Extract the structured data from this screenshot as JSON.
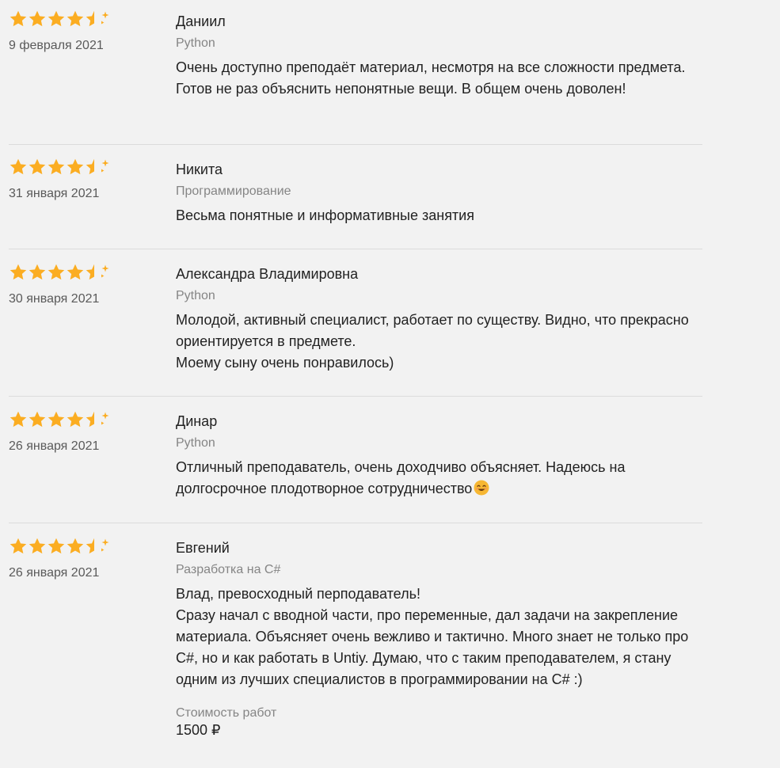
{
  "colors": {
    "star": "#fbad22",
    "text": "#222222",
    "muted": "#858585",
    "divider": "#dcdcdc",
    "background": "#f2f2f2"
  },
  "reviews": [
    {
      "rating": 4.5,
      "date": "9 февраля 2021",
      "author": "Даниил",
      "subject": "Python",
      "text": "Очень доступно преподаёт материал, несмотря на все сложности предмета. Готов не раз объяснить непонятные вещи. В общем очень доволен!"
    },
    {
      "rating": 4.5,
      "date": "31 января 2021",
      "author": "Никита",
      "subject": "Программирование",
      "text": "Весьма понятные и информативные занятия"
    },
    {
      "rating": 4.5,
      "date": "30 января 2021",
      "author": "Александра Владимировна",
      "subject": "Python",
      "text": "Молодой, активный специалист, работает по существу. Видно, что прекрасно ориентируется в предмете.\nМоему сыну очень понравилось)"
    },
    {
      "rating": 4.5,
      "date": "26 января 2021",
      "author": "Динар",
      "subject": "Python",
      "text": "Отличный преподаватель, очень доходчиво объясняет. Надеюсь на долгосрочное плодотворное сотрудничество",
      "emoji": "smiling-face-icon"
    },
    {
      "rating": 4.5,
      "date": "26 января 2021",
      "author": "Евгений",
      "subject": "Разработка на C#",
      "text": "Влад, превосходный перподаватель!\nСразу начал с вводной части, про переменные, дал задачи на закрепление материала. Объясняет очень вежливо и тактично. Много знает не только про C#, но и как работать в Untiy. Думаю, что с таким преподавателем, я стану одним из лучших специалистов в программировании на C# :)",
      "cost_label": "Стоимость работ",
      "cost_value": "1500 ₽"
    }
  ]
}
